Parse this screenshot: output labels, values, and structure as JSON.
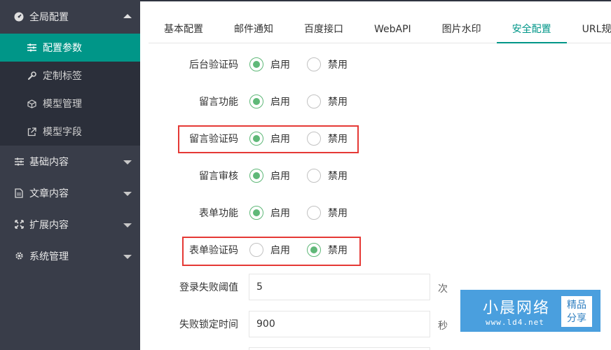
{
  "sidebar": {
    "groups": [
      {
        "label": "全局配置",
        "icon": "dashboard-icon"
      },
      {
        "label": "基础内容",
        "icon": "sliders-icon"
      },
      {
        "label": "文章内容",
        "icon": "file-icon"
      },
      {
        "label": "扩展内容",
        "icon": "expand-icon"
      },
      {
        "label": "系统管理",
        "icon": "gear-icon"
      }
    ],
    "sub_items": [
      {
        "label": "配置参数",
        "icon": "sliders-icon"
      },
      {
        "label": "定制标签",
        "icon": "wrench-icon"
      },
      {
        "label": "模型管理",
        "icon": "cube-icon"
      },
      {
        "label": "模型字段",
        "icon": "external-link-icon"
      }
    ]
  },
  "tabs": [
    "基本配置",
    "邮件通知",
    "百度接口",
    "WebAPI",
    "图片水印",
    "安全配置",
    "URL规则"
  ],
  "active_tab": "安全配置",
  "radio_labels": {
    "on": "启用",
    "off": "禁用"
  },
  "settings": [
    {
      "label": "后台验证码",
      "value": "启用"
    },
    {
      "label": "留言功能",
      "value": "启用"
    },
    {
      "label": "留言验证码",
      "value": "启用"
    },
    {
      "label": "留言审核",
      "value": "启用"
    },
    {
      "label": "表单功能",
      "value": "启用"
    },
    {
      "label": "表单验证码",
      "value": "禁用"
    }
  ],
  "inputs": [
    {
      "label": "登录失败阈值",
      "value": "5",
      "unit": "次"
    },
    {
      "label": "失败锁定时间",
      "value": "900",
      "unit": "秒"
    }
  ],
  "watermark": {
    "title": "小晨网络",
    "url": "www.ld4.net",
    "stamp_line1": "精品",
    "stamp_line2": "分享"
  },
  "colors": {
    "accent": "#009688",
    "radio_checked": "#5fb878",
    "highlight": "#e53935",
    "sidebar_bg": "#393d49",
    "badge_bg": "#4a9fde"
  }
}
